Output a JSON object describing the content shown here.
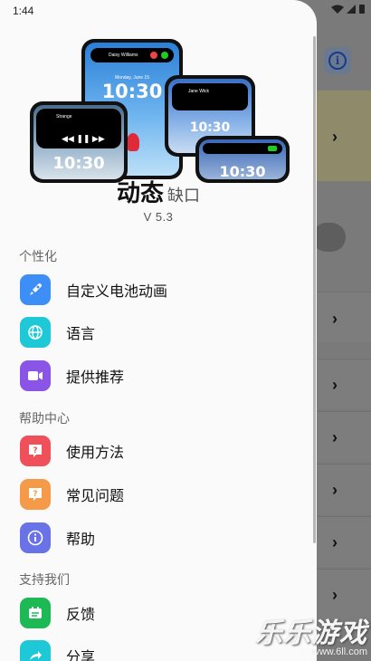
{
  "status": {
    "time": "1:44"
  },
  "app": {
    "name": "动态",
    "subtitle": "缺口",
    "version": "V 5.3"
  },
  "hero": {
    "phone_time": "10:30",
    "phone_date": "Monday, June 15",
    "caller_name": "Daisy Williams",
    "song_title": "Strange",
    "chat_name": "Jane Wick"
  },
  "sections": [
    {
      "title": "个性化",
      "items": [
        {
          "label": "自定义电池动画",
          "icon": "rocket-icon",
          "color": "#3d8ef7"
        },
        {
          "label": "语言",
          "icon": "globe-icon",
          "color": "#1ec8d6"
        },
        {
          "label": "提供推荐",
          "icon": "video-camera-icon",
          "color": "#8a55e6"
        }
      ]
    },
    {
      "title": "帮助中心",
      "items": [
        {
          "label": "使用方法",
          "icon": "question-bubble-icon",
          "color": "#f0505a"
        },
        {
          "label": "常见问题",
          "icon": "faq-bubble-icon",
          "color": "#f59a48"
        },
        {
          "label": "帮助",
          "icon": "info-icon",
          "color": "#6a72e8"
        }
      ]
    },
    {
      "title": "支持我们",
      "items": [
        {
          "label": "反馈",
          "icon": "feedback-icon",
          "color": "#1db954"
        },
        {
          "label": "分享",
          "icon": "share-icon",
          "color": "#1ec8d6"
        }
      ]
    }
  ],
  "watermark": {
    "text": "乐乐游戏",
    "url": "www.6ll.com"
  }
}
